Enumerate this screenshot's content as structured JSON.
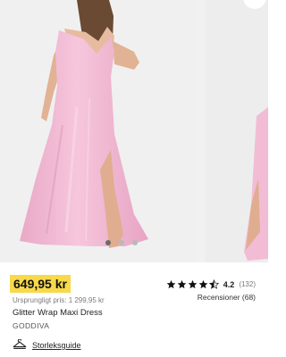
{
  "product": {
    "price": "649,95 kr",
    "original_price": "Ursprungligt pris: 1 299,95 kr",
    "name": "Glitter Wrap Maxi Dress",
    "brand": "GODDIVA",
    "size_guide": "Storleksguide"
  },
  "rating": {
    "value": "4.2",
    "count": "(132)",
    "reviews_link": "Recensioner (68)",
    "stars_filled": 4.2,
    "stars_max": 5
  },
  "gallery": {
    "slide_count": 3,
    "active_index": 0
  },
  "colors": {
    "price_highlight": "#f7d94a",
    "dress": "#f2b9d4"
  },
  "icons": {
    "wishlist": "heart-icon",
    "size_guide": "hanger-icon",
    "rating": "star-icon"
  }
}
